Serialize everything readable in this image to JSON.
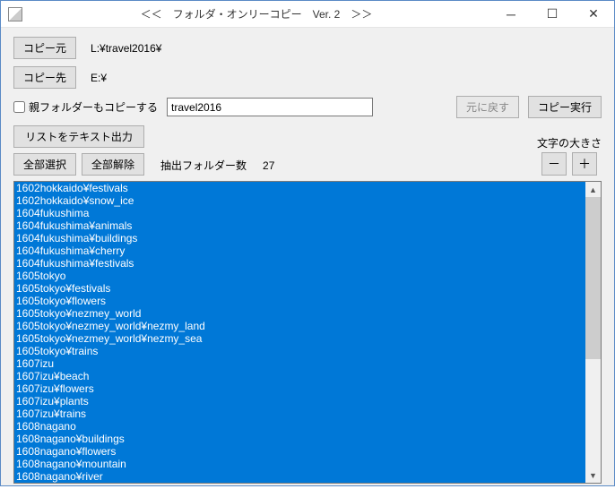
{
  "window": {
    "title": "＜＜　フォルダ・オンリーコピー　Ver. 2　＞＞"
  },
  "buttons": {
    "copy_src": "コピー元",
    "copy_dst": "コピー先",
    "undo": "元に戻す",
    "run": "コピー実行",
    "export_list": "リストをテキスト出力",
    "select_all": "全部選択",
    "deselect_all": "全部解除",
    "size_minus": "－",
    "size_plus": "＋"
  },
  "paths": {
    "src": "L:¥travel2016¥",
    "dst": "E:¥"
  },
  "options": {
    "copy_parent_label": "親フォルダーもコピーする",
    "folder_name_value": "travel2016"
  },
  "labels": {
    "folder_count": "抽出フォルダー数",
    "font_size": "文字の大きさ"
  },
  "values": {
    "folder_count": "27"
  },
  "folders": [
    "1602hokkaido¥festivals",
    "1602hokkaido¥snow_ice",
    "1604fukushima",
    "1604fukushima¥animals",
    "1604fukushima¥buildings",
    "1604fukushima¥cherry",
    "1604fukushima¥festivals",
    "1605tokyo",
    "1605tokyo¥festivals",
    "1605tokyo¥flowers",
    "1605tokyo¥nezmey_world",
    "1605tokyo¥nezmey_world¥nezmy_land",
    "1605tokyo¥nezmey_world¥nezmy_sea",
    "1605tokyo¥trains",
    "1607izu",
    "1607izu¥beach",
    "1607izu¥flowers",
    "1607izu¥plants",
    "1607izu¥trains",
    "1608nagano",
    "1608nagano¥buildings",
    "1608nagano¥flowers",
    "1608nagano¥mountain",
    "1608nagano¥river"
  ]
}
